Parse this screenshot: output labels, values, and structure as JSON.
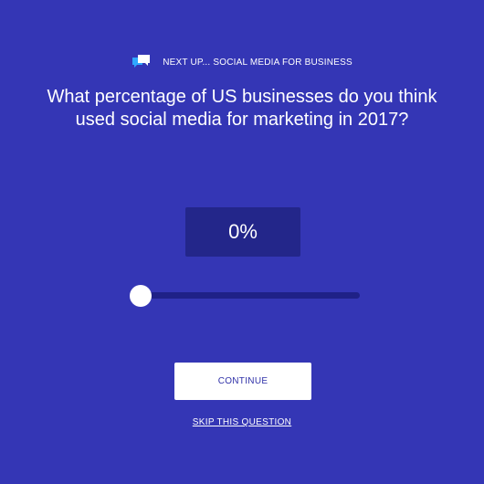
{
  "header": {
    "icon": "chat-bubbles-icon",
    "next_up": "NEXT UP... SOCIAL MEDIA FOR BUSINESS"
  },
  "question": {
    "text": "What percentage of US businesses do you think used social media for marketing in 2017?"
  },
  "answer": {
    "value_label": "0%",
    "value": 0,
    "min": 0,
    "max": 100
  },
  "actions": {
    "continue_label": "CONTINUE",
    "skip_label": "SKIP THIS QUESTION"
  },
  "colors": {
    "background": "#3436b5",
    "value_box": "#23268a",
    "track": "#1f2187",
    "thumb": "#ffffff",
    "icon_front": "#ffffff",
    "icon_back": "#2fa7ff"
  }
}
